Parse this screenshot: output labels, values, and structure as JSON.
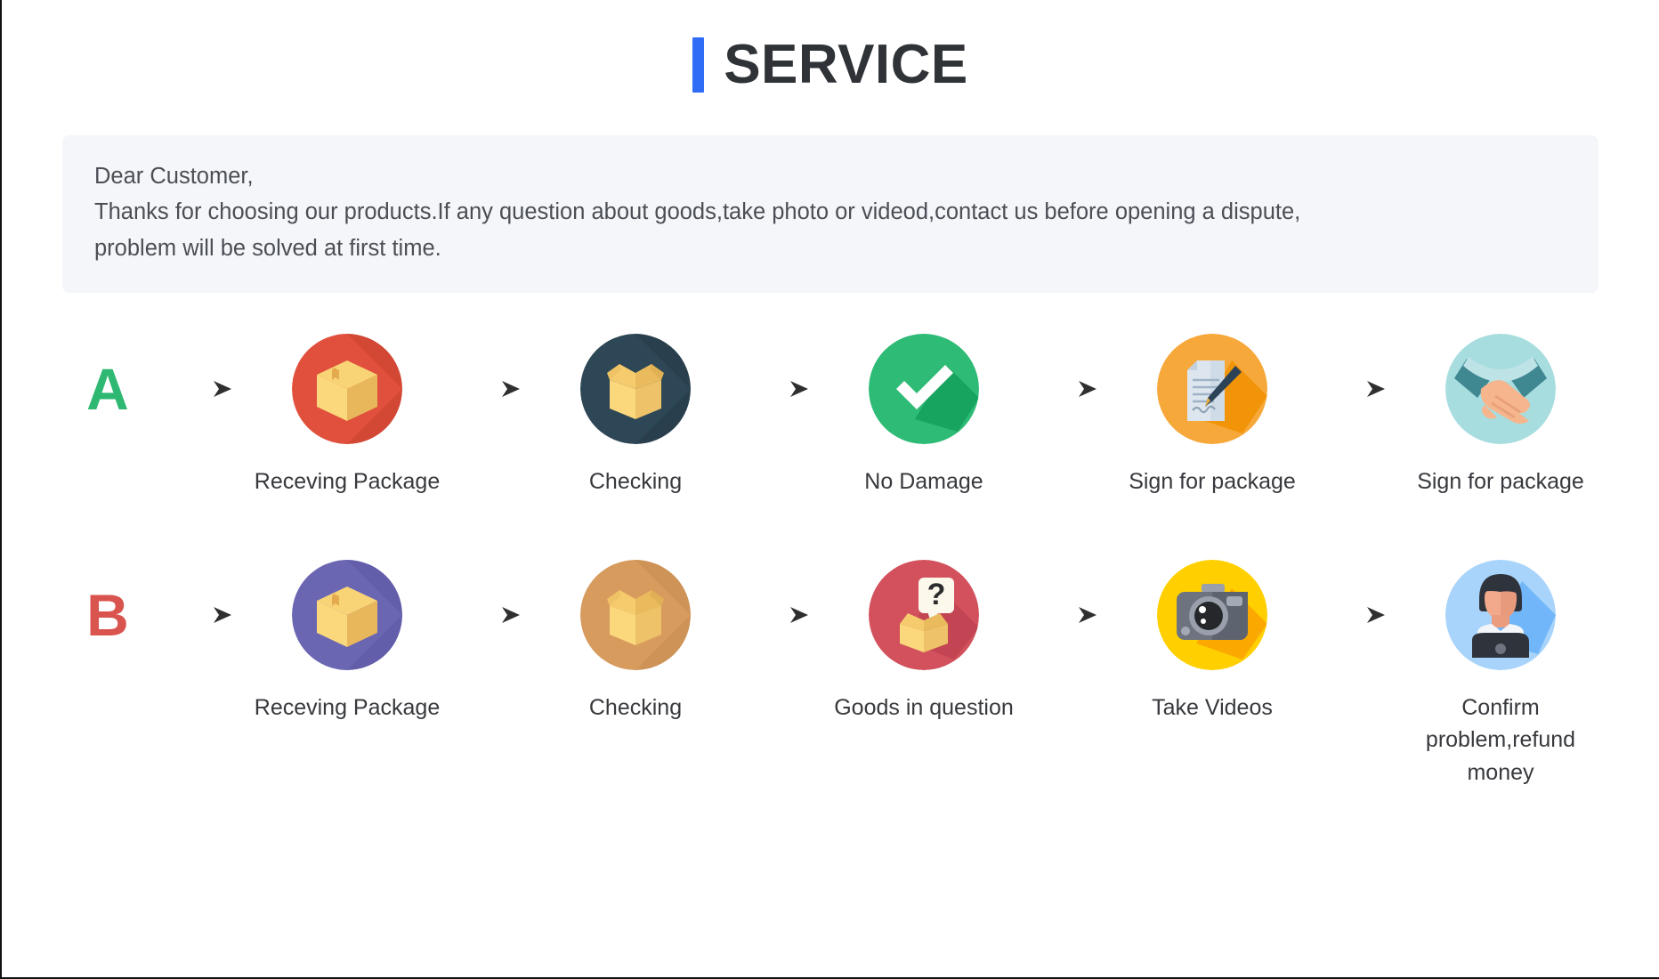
{
  "header": {
    "title": "SERVICE",
    "accent_color": "#2f6df6"
  },
  "notice": {
    "line1": "Dear Customer,",
    "line2": "Thanks for choosing our products.If any question about goods,take photo or videod,contact us before opening a dispute,",
    "line3": "problem will be solved at first time.",
    "background_color": "#f4f6fa"
  },
  "flows": [
    {
      "badge": "A",
      "badge_color": "#2eb872",
      "steps": [
        {
          "label": "Receving Package",
          "icon": "package-box-icon",
          "circle_color": "#e0503c",
          "shadow_color": "#c9402f"
        },
        {
          "label": "Checking",
          "icon": "open-box-icon",
          "circle_color": "#2e4756",
          "shadow_color": "#233744"
        },
        {
          "label": "No Damage",
          "icon": "check-mark-icon",
          "circle_color": "#2ebb76",
          "shadow_color": "#12a05c"
        },
        {
          "label": "Sign for package",
          "icon": "document-signature-icon",
          "circle_color": "#f7a83a",
          "shadow_color": "#f09100"
        },
        {
          "label": "Sign for package",
          "icon": "handshake-icon",
          "circle_color": "#a8dde0",
          "shadow_color": "#9ad2d6"
        }
      ]
    },
    {
      "badge": "B",
      "badge_color": "#d9544e",
      "steps": [
        {
          "label": "Receving Package",
          "icon": "package-box-icon",
          "circle_color": "#6a66b2",
          "shadow_color": "#5a56a0"
        },
        {
          "label": "Checking",
          "icon": "open-box-icon",
          "circle_color": "#d79b5e",
          "shadow_color": "#c58c4f"
        },
        {
          "label": "Goods in question",
          "icon": "question-box-icon",
          "circle_color": "#d3515d",
          "shadow_color": "#bf4250"
        },
        {
          "label": "Take Videos",
          "icon": "camera-icon",
          "circle_color": "#ffcf00",
          "shadow_color": "#fba400"
        },
        {
          "label": "Confirm  problem,refund money",
          "icon": "support-agent-icon",
          "circle_color": "#a8d4fb",
          "shadow_color": "#62aef7"
        }
      ]
    }
  ],
  "arrow": {
    "icon": "arrow-right-icon",
    "color": "#3a3a3a"
  }
}
